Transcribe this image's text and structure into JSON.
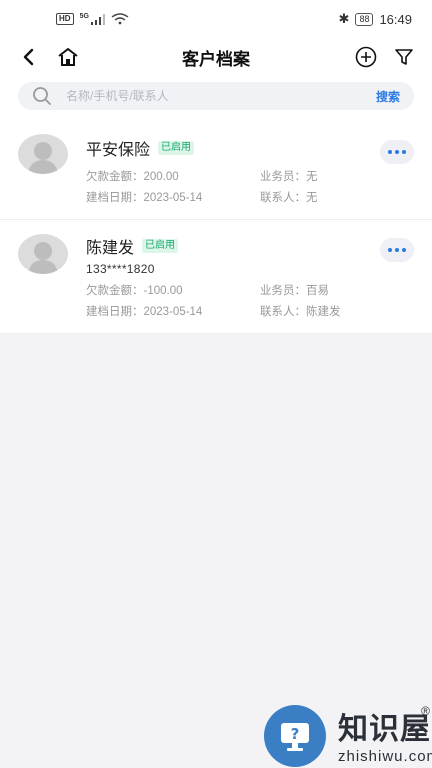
{
  "status_bar": {
    "hd": "HD",
    "net": "5G",
    "battery": "88",
    "time": "16:49"
  },
  "header": {
    "title": "客户档案",
    "back_icon": "chevron-left-icon",
    "home_icon": "home-icon",
    "add_icon": "plus-circle-icon",
    "filter_icon": "filter-icon"
  },
  "search": {
    "placeholder": "名称/手机号/联系人",
    "value": "",
    "button_label": "搜索"
  },
  "customers": [
    {
      "name": "平安保险",
      "status": "已启用",
      "phone": "",
      "debt_label": "欠款金额：",
      "debt_value": "200.00",
      "salesman_label": "业务员：",
      "salesman_value": "无",
      "date_label": "建档日期：",
      "date_value": "2023-05-14",
      "contact_label": "联系人：",
      "contact_value": "无"
    },
    {
      "name": "陈建发",
      "status": "已启用",
      "phone": "133****1820",
      "debt_label": "欠款金额：",
      "debt_value": "-100.00",
      "salesman_label": "业务员：",
      "salesman_value": "百易",
      "date_label": "建档日期：",
      "date_value": "2023-05-14",
      "contact_label": "联系人：",
      "contact_value": "陈建发"
    }
  ],
  "watermark": {
    "main": "知识屋",
    "sub": "zhishiwu.com",
    "reg": "®"
  },
  "colors": {
    "accent": "#2a7ae2",
    "status_green": "#19a96c",
    "page_bg": "#f3f3f5"
  }
}
